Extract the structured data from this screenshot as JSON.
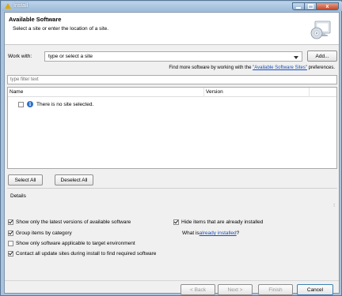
{
  "window": {
    "title": "Install",
    "app_icon": "warning-triangle-icon",
    "controls": {
      "minimize_icon": "minimize-icon",
      "maximize_icon": "maximize-icon",
      "close_icon": "close-icon",
      "close_glyph": "x"
    }
  },
  "banner": {
    "title": "Available Software",
    "subtitle": "Select a site or enter the location of a site.",
    "icon": "install-wizard-icon"
  },
  "work_with": {
    "label": "Work with:",
    "value": "type or select a site",
    "add_label": "Add..."
  },
  "find_more": {
    "prefix": "Find more software by working with the ",
    "link": "\"Available Software Sites\"",
    "suffix": " preferences."
  },
  "filter": {
    "placeholder": "type filter text"
  },
  "tree": {
    "columns": [
      "Name",
      "Version"
    ],
    "items": [
      {
        "text": "There is no site selected.",
        "checked": false,
        "icon": "info-icon"
      }
    ]
  },
  "selection_buttons": {
    "select_all": "Select All",
    "deselect_all": "Deselect All"
  },
  "details": {
    "label": "Details"
  },
  "options": {
    "latest_versions": {
      "label": "Show only the latest versions of available software",
      "checked": true
    },
    "group_by_category": {
      "label": "Group items by category",
      "checked": true
    },
    "target_env": {
      "label": "Show only software applicable to target environment",
      "checked": false
    },
    "contact_sites": {
      "label": "Contact all update sites during install to find required software",
      "checked": true
    },
    "hide_installed": {
      "label": "Hide items that are already installed",
      "checked": true
    },
    "what_is_installed": {
      "prefix": "What is ",
      "link": "already installed",
      "suffix": "?"
    }
  },
  "nav_buttons": {
    "back": "< Back",
    "next": "Next >",
    "finish": "Finish",
    "cancel": "Cancel"
  },
  "colors": {
    "link": "#1a4fb5",
    "title_bar": "#a9c3dd",
    "dialog_bg": "#f0f0f0",
    "info": "#2f6fc8"
  }
}
